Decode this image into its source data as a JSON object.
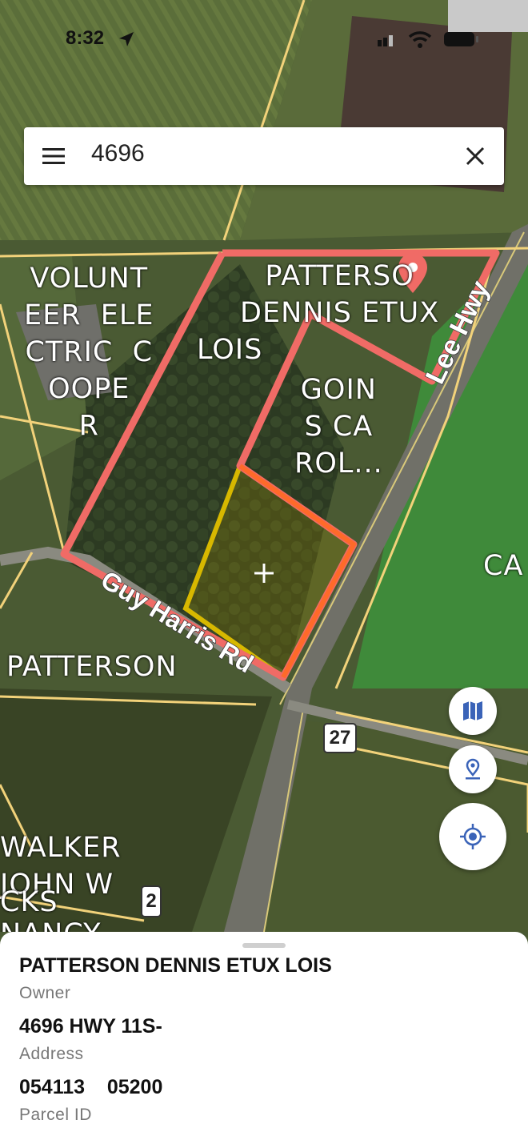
{
  "status_bar": {
    "time": "8:32"
  },
  "search": {
    "query": "4696"
  },
  "map_labels": {
    "parcel_volunteer": "VOLUNT\nEER  ELE\nCTRIC  C\nOOPE\nR",
    "parcel_patterson_dennis": "PATTERSO\nDENNIS ETUX",
    "parcel_lois": "LOIS",
    "parcel_goins": "GOIN\nS CA\nROL...",
    "parcel_patterson": "PATTERSON",
    "parcel_walker": "WALKER\nJOHN W",
    "parcel_cks": "CKS",
    "parcel_nancy": "NANCY",
    "parcel_ca": "CA",
    "road_lee_hwy": "Lee Hwy",
    "road_guy_harris": "Guy Harris Rd",
    "route_27": "27",
    "route_2": "2"
  },
  "details": {
    "owner_value": "PATTERSON DENNIS ETUX LOIS",
    "owner_label": "Owner",
    "address_value": "4696 HWY 11S-",
    "address_label": "Address",
    "parcel_value": "054113    05200",
    "parcel_label": "Parcel ID"
  },
  "colors": {
    "selected_parcel_outline": "#f06b66",
    "highlight_parcel": "#e8c400",
    "parcel_lines": "#f2d27a",
    "fab_icon": "#3a63b8"
  },
  "icons": [
    "location-arrow-icon",
    "signal-icon",
    "wifi-icon",
    "battery-icon",
    "menu-icon",
    "close-icon",
    "map-pin-icon",
    "layers-icon",
    "place-icon",
    "my-location-icon"
  ]
}
